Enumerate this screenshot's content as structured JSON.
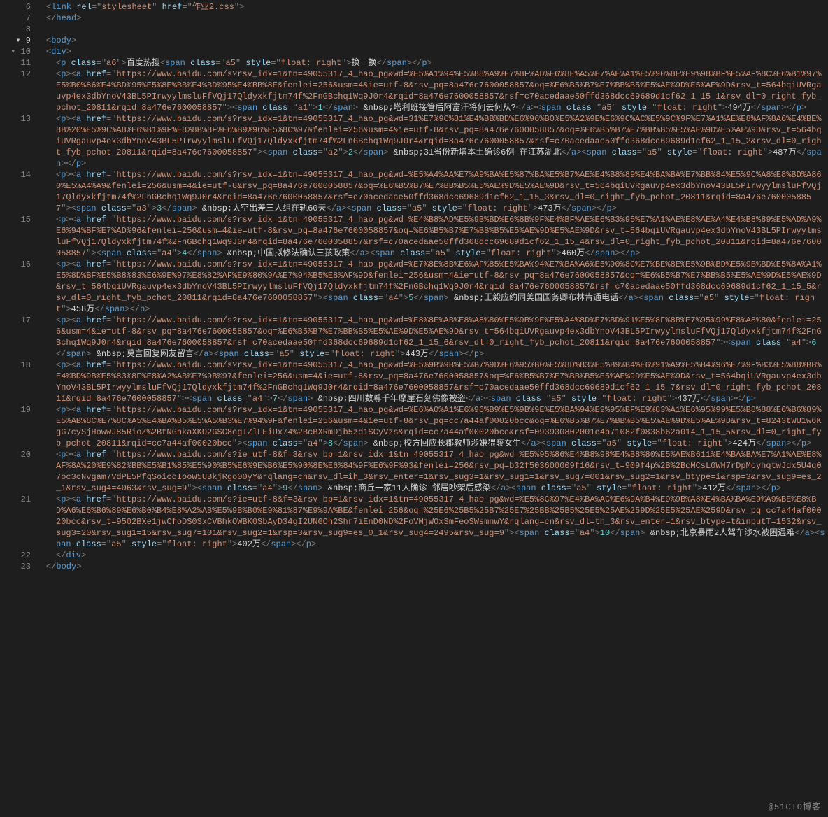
{
  "watermark": "@51CTO博客",
  "line6": {
    "tag": "link",
    "attrs": [
      {
        "n": "rel",
        "v": "stylesheet"
      },
      {
        "n": "href",
        "v": "作业2.css"
      }
    ]
  },
  "line7": {
    "close": "head"
  },
  "line9": {
    "open": "body"
  },
  "line10": {
    "open": "div"
  },
  "line11": {
    "p_class": "a6",
    "title": "百度热搜",
    "span_class": "a5",
    "span_style": "float: right",
    "span_text": "换一换"
  },
  "items": [
    {
      "ln": "12",
      "href": "https://www.baidu.com/s?rsv_idx=1&tn=49055317_4_hao_pg&wd=%E5%A1%94%E5%88%A9%E7%8F%AD%E6%8E%A5%E7%AE%A1%E5%90%8E%E9%98%BF%E5%AF%8C%E6%B1%97%E5%B0%86%E4%BD%95%E5%8E%BB%E4%BD%95%E4%BB%8E&fenlei=256&usm=4&ie=utf-8&rsv_pq=8a476e7600058857&oq=%E6%B5%B7%E7%BB%B5%E5%AE%9D%E5%AE%9D&rsv_t=564bqiUVRgauvp4ex3dbYnoV43BL5PIrwyylmsluFfVQj17Qldyxkfjtm74f%2FnGBchq1Wq9J0r4&rqid=8a476e7600058857&rsf=c70acedaae50ffd368dcc69689d1cf62_1_15_1&rsv_dl=0_right_fyb_pchot_20811&rqid=8a476e7600058857",
      "badge_class": "a1",
      "badge_num": "1",
      "title": "塔利班接管后阿富汗将何去何从?",
      "right_class": "a5",
      "right_style": "float: right",
      "count": "494万"
    },
    {
      "ln": "13",
      "href": "https://www.baidu.com/s?rsv_idx=1&tn=49055317_4_hao_pg&wd=31%E7%9C%81%E4%BB%BD%E6%96%B0%E5%A2%9E%E6%9C%AC%E5%9C%9F%E7%A1%AE%E8%AF%8A6%E4%BE%8B%20%E5%9C%A8%E6%B1%9F%E8%8B%8F%E6%B9%96%E5%8C%97&fenlei=256&usm=4&ie=utf-8&rsv_pq=8a476e7600058857&oq=%E6%B5%B7%E7%BB%B5%E5%AE%9D%E5%AE%9D&rsv_t=564bqiUVRgauvp4ex3dbYnoV43BL5PIrwyylmsluFfVQj17Qldyxkfjtm74f%2FnGBchq1Wq9J0r4&rqid=8a476e7600058857&rsf=c70acedaae50ffd368dcc69689d1cf62_1_15_2&rsv_dl=0_right_fyb_pchot_20811&rqid=8a476e7600058857",
      "badge_class": "a2",
      "badge_num": "2",
      "title": "31省份新增本土确诊6例 在江苏湖北",
      "right_class": "a5",
      "right_style": "float: right",
      "count": "487万"
    },
    {
      "ln": "14",
      "href": "https://www.baidu.com/s?rsv_idx=1&tn=49055317_4_hao_pg&wd=%E5%A4%AA%E7%A9%BA%E5%87%BA%E5%B7%AE%E4%B8%89%E4%BA%BA%E7%BB%84%E5%9C%A8%E8%BD%A860%E5%A4%A9&fenlei=256&usm=4&ie=utf-8&rsv_pq=8a476e7600058857&oq=%E6%B5%B7%E7%BB%B5%E5%AE%9D%E5%AE%9D&rsv_t=564bqiUVRgauvp4ex3dbYnoV43BL5PIrwyylmsluFfVQj17Qldyxkfjtm74f%2FnGBchq1Wq9J0r4&rqid=8a476e7600058857&rsf=c70acedaae50ffd368dcc69689d1cf62_1_15_3&rsv_dl=0_right_fyb_pchot_20811&rqid=8a476e7600058857",
      "badge_class": "a3",
      "badge_num": "3",
      "title": "太空出差三人组在轨60天",
      "right_class": "a5",
      "right_style": "float: right",
      "count": "473万"
    },
    {
      "ln": "15",
      "href": "https://www.baidu.com/s?rsv_idx=1&tn=49055317_4_hao_pg&wd=%E4%B8%AD%E5%9B%BD%E6%8B%9F%E4%BF%AE%E6%B3%95%E7%A1%AE%E8%AE%A4%E4%B8%89%E5%AD%A9%E6%94%BF%E7%AD%96&fenlei=256&usm=4&ie=utf-8&rsv_pq=8a476e7600058857&oq=%E6%B5%B7%E7%BB%B5%E5%AE%9D%E5%AE%9D&rsv_t=564bqiUVRgauvp4ex3dbYnoV43BL5PIrwyylmsluFfVQj17Qldyxkfjtm74f%2FnGBchq1Wq9J0r4&rqid=8a476e7600058857&rsf=c70acedaae50ffd368dcc69689d1cf62_1_15_4&rsv_dl=0_right_fyb_pchot_20811&rqid=8a476e7600058857",
      "badge_class": "a4",
      "badge_num": "4",
      "title": "中国拟修法确认三孩政策",
      "right_class": "a5",
      "right_style": "float: right",
      "count": "460万"
    },
    {
      "ln": "16",
      "href": "https://www.baidu.com/s?rsv_idx=1&tn=49055317_4_hao_pg&wd=%E7%8E%8B%E6%AF%85%E5%BA%94%E7%BA%A6%E5%90%8C%E7%BE%8E%E5%9B%BD%E5%9B%BD%E5%8A%A1%E5%8D%BF%E5%B8%83%E6%9E%97%E8%82%AF%E9%80%9A%E7%94%B5%E8%AF%9D&fenlei=256&usm=4&ie=utf-8&rsv_pq=8a476e7600058857&oq=%E6%B5%B7%E7%BB%B5%E5%AE%9D%E5%AE%9D&rsv_t=564bqiUVRgauvp4ex3dbYnoV43BL5PIrwyylmsluFfVQj17Qldyxkfjtm74f%2FnGBchq1Wq9J0r4&rqid=8a476e7600058857&rsf=c70acedaae50ffd368dcc69689d1cf62_1_15_5&rsv_dl=0_right_fyb_pchot_20811&rqid=8a476e7600058857",
      "badge_class": "a4",
      "badge_num": "5",
      "title": "王毅应约同美国国务卿布林肯通电话",
      "right_class": "a5",
      "right_style": "float: right",
      "count": "458万"
    },
    {
      "ln": "17",
      "href": "https://www.baidu.com/s?rsv_idx=1&tn=49055317_4_hao_pg&wd=%E8%8E%AB%E8%A8%80%E5%9B%9E%E5%A4%8D%E7%BD%91%E5%8F%8B%E7%95%99%E8%A8%80&fenlei=256&usm=4&ie=utf-8&rsv_pq=8a476e7600058857&oq=%E6%B5%B7%E7%BB%B5%E5%AE%9D%E5%AE%9D&rsv_t=564bqiUVRgauvp4ex3dbYnoV43BL5PIrwyylmsluFfVQj17Qldyxkfjtm74f%2FnGBchq1Wq9J0r4&rqid=8a476e7600058857&rsf=c70acedaae50ffd368dcc69689d1cf62_1_15_6&rsv_dl=0_right_fyb_pchot_20811&rqid=8a476e7600058857",
      "badge_class": "a4",
      "badge_num": "6",
      "title": "莫言回复网友留言",
      "right_class": "a5",
      "right_style": "float: right",
      "count": "443万"
    },
    {
      "ln": "18",
      "href": "https://www.baidu.com/s?rsv_idx=1&tn=49055317_4_hao_pg&wd=%E5%9B%9B%E5%B7%9D%E6%95%B0%E5%8D%83%E5%B9%B4%E6%91%A9%E5%B4%96%E7%9F%B3%E5%88%BB%E4%BD%9B%E5%83%8F%E8%A2%AB%E7%9B%97&fenlei=256&usm=4&ie=utf-8&rsv_pq=8a476e7600058857&oq=%E6%B5%B7%E7%BB%B5%E5%AE%9D%E5%AE%9D&rsv_t=564bqiUVRgauvp4ex3dbYnoV43BL5PIrwyylmsluFfVQj17Qldyxkfjtm74f%2FnGBchq1Wq9J0r4&rqid=8a476e7600058857&rsf=c70acedaae50ffd368dcc69689d1cf62_1_15_7&rsv_dl=0_right_fyb_pchot_20811&rqid=8a476e7600058857",
      "badge_class": "a4",
      "badge_num": "7",
      "title": "四川数尊千年摩崖石刻佛像被盗",
      "right_class": "a5",
      "right_style": "float: right",
      "count": "437万"
    },
    {
      "ln": "19",
      "href": "https://www.baidu.com/s?rsv_idx=1&tn=49055317_4_hao_pg&wd=%E6%A0%A1%E6%96%B9%E5%9B%9E%E5%BA%94%E9%95%BF%E9%83%A1%E6%95%99%E5%B8%88%E6%B6%89%E5%AB%8C%E7%8C%A5%E4%BA%B5%E5%A5%B3%E7%94%9F&fenlei=256&usm=4&ie=utf-8&rsv_pq=cc7a44af00020bcc&oq=%E6%B5%B7%E7%BB%B5%E5%AE%9D%E5%AE%9D&rsv_t=8243tWU1w6KgG7cySjHowwJ85RioZ%2BtNGhkaXKO2GSC8cgTZlFEiUx74%2BcBXRmDjb5zd1SCyVzs&rqid=cc7a44af00020bcc&rsf=093930802001e4b71082f0838b62a014_1_15_5&rsv_dl=0_right_fyb_pchot_20811&rqid=cc7a44af00020bcc",
      "badge_class": "a4",
      "badge_num": "8",
      "title": "校方回应长郡教师涉嫌猥亵女生",
      "right_class": "a5",
      "right_style": "float: right",
      "count": "424万"
    },
    {
      "ln": "20",
      "href": "https://www.baidu.com/s?ie=utf-8&f=3&rsv_bp=1&rsv_idx=1&tn=49055317_4_hao_pg&wd=%E5%95%86%E4%B8%98%E4%B8%80%E5%AE%B611%E4%BA%BA%E7%A1%AE%E8%AF%8A%20%E9%82%BB%E5%B1%85%E5%90%B5%E6%9E%B6%E5%90%8E%E6%84%9F%E6%9F%93&fenlei=256&rsv_pq=b32f503600009f16&rsv_t=909f4p%2B%2BcMCsL0WH7rDpMcyhqtwJdx5U4q07oc3cNvgam7VdPE5PfqSoicoIooW5UBkjRgo00yY&rqlang=cn&rsv_dl=ih_3&rsv_enter=1&rsv_sug3=1&rsv_sug1=1&rsv_sug7=001&rsv_sug2=1&rsv_btype=i&rsp=3&rsv_sug9=es_2_1&rsv_sug4=4063&rsv_sug=9",
      "badge_class": "a4",
      "badge_num": "9",
      "title": "商丘一家11人确诊 邻居吵架后感染",
      "right_class": "a5",
      "right_style": "float: right",
      "count": "412万"
    },
    {
      "ln": "21",
      "href": "https://www.baidu.com/s?ie=utf-8&f=3&rsv_bp=1&rsv_idx=1&tn=49055317_4_hao_pg&wd=%E5%8C%97%E4%BA%AC%E6%9A%B4%E9%9B%A8%E4%BA%BA%E9%A9%BE%E8%BD%A6%E6%B6%89%E6%B0%B4%E8%A2%AB%E5%9B%B0%E9%81%87%E9%9A%BE&fenlei=256&oq=%25E6%25B5%25B7%25E7%25BB%25B5%25E5%25AE%259D%25E5%25AE%259D&rsv_pq=cc7a44af00020bcc&rsv_t=9502BXe1jwCfoDS0SxCVBhkOWBK0SbAyD34gI2UNGOh2Shr7iEnD0ND%2FoVMjWOxSmFeoSWsmnwY&rqlang=cn&rsv_dl=th_3&rsv_enter=1&rsv_btype=t&inputT=1532&rsv_sug3=20&rsv_sug1=15&rsv_sug7=101&rsv_sug2=1&rsp=3&rsv_sug9=es_0_1&rsv_sug4=2495&rsv_sug=9",
      "badge_class": "a4",
      "badge_num": "10",
      "title": "北京暴雨2人驾车涉水被困遇难",
      "right_class": "a5",
      "right_style": "float: right",
      "count": "402万"
    }
  ],
  "line22": {
    "close": "div"
  },
  "line23": {
    "close": "body"
  },
  "gutter": [
    {
      "n": "6"
    },
    {
      "n": "7"
    },
    {
      "n": "8"
    },
    {
      "n": "9",
      "arrow": true,
      "cur": true
    },
    {
      "n": "10",
      "arrow": true
    },
    {
      "n": "11"
    },
    {
      "n": "12"
    },
    {
      "n": "13"
    },
    {
      "n": "14"
    },
    {
      "n": "15"
    },
    {
      "n": "16"
    },
    {
      "n": "17"
    },
    {
      "n": "18"
    },
    {
      "n": "19"
    },
    {
      "n": "20"
    },
    {
      "n": "21"
    },
    {
      "n": "22"
    },
    {
      "n": "23"
    }
  ]
}
